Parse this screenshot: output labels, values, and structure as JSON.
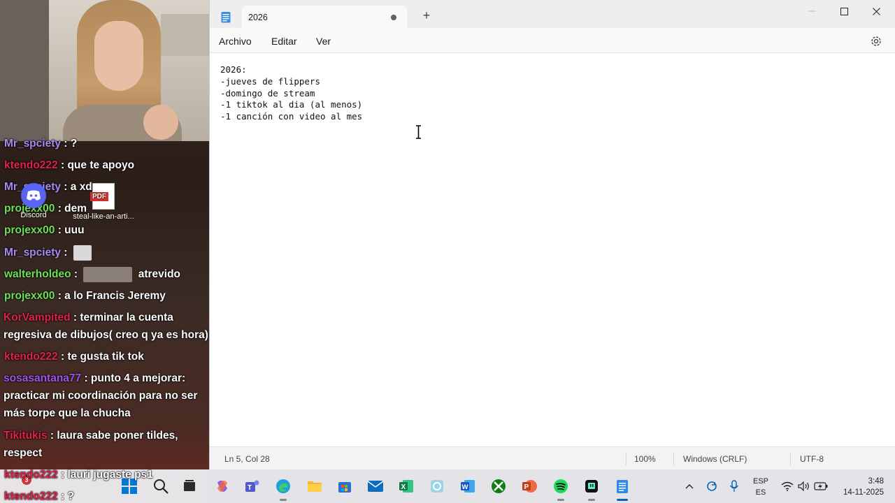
{
  "notepad": {
    "tab_title": "2026",
    "new_tab_symbol": "+",
    "menu": [
      "Archivo",
      "Editar",
      "Ver"
    ],
    "lines": [
      "2026:",
      "-jueves de flippers",
      "-domingo de stream",
      "-1 tiktok al dia (al menos)",
      "-1 canción con video al mes"
    ],
    "status": {
      "position": "Ln 5, Col 28",
      "zoom": "100%",
      "line_ending": "Windows (CRLF)",
      "encoding": "UTF-8"
    }
  },
  "desktop_icons": [
    {
      "label": "Discord"
    },
    {
      "label": "steal-like-an-arti...",
      "badge": "PDF"
    }
  ],
  "chat": [
    {
      "user": "Mr_spciety",
      "text": ": ?",
      "color": "#a78cf0"
    },
    {
      "user": "ktendo222",
      "text": ": que te apoyo",
      "color": "#e0234a"
    },
    {
      "user": "Mr_spciety",
      "text": ": a xd",
      "color": "#a78cf0"
    },
    {
      "user": "projexx00",
      "text": ": dem",
      "color": "#6ee05a"
    },
    {
      "user": "projexx00",
      "text": ": uuu",
      "color": "#6ee05a"
    },
    {
      "user": "Mr_spciety",
      "text": ":",
      "color": "#a78cf0"
    },
    {
      "user": "walterholdeo",
      "text": ":",
      "text2": "atrevido",
      "color": "#6ee05a"
    },
    {
      "user": "projexx00",
      "text": ": a lo Francis Jeremy",
      "color": "#6ee05a"
    },
    {
      "user": "KorVampited",
      "text": ": terminar la cuenta regresiva de dibujos( creo q ya es hora)",
      "color": "#e0234a"
    },
    {
      "user": "ktendo222",
      "text": ": te gusta tik tok",
      "color": "#e0234a"
    },
    {
      "user": "sosasantana77",
      "text": ": punto 4 a mejorar: practicar mi coordinación para no ser más torpe que la chucha",
      "color": "#a155e8"
    },
    {
      "user": "Tikitukis",
      "text": ": laura sabe poner tildes, respect",
      "color": "#e0234a"
    },
    {
      "user": "ktendo222",
      "text": ": lauri jugaste ps1",
      "color": "#e0234a"
    },
    {
      "user": "ktendo222",
      "text": ": ?",
      "color": "#e0234a"
    }
  ],
  "taskbar": {
    "notification_count": "3",
    "apps": [
      "start-icon",
      "search-icon",
      "task-view-icon",
      "copilot-icon",
      "teams-icon",
      "edge-icon",
      "file-explorer-icon",
      "store-icon",
      "mail-icon",
      "excel-icon",
      "app-icon",
      "word-icon",
      "xbox-icon",
      "powerpoint-icon",
      "spotify-icon",
      "twitch-icon",
      "notepad-icon"
    ],
    "language": {
      "line1": "ESP",
      "line2": "ES"
    },
    "time": "3:48",
    "date": "14-11-2025"
  }
}
